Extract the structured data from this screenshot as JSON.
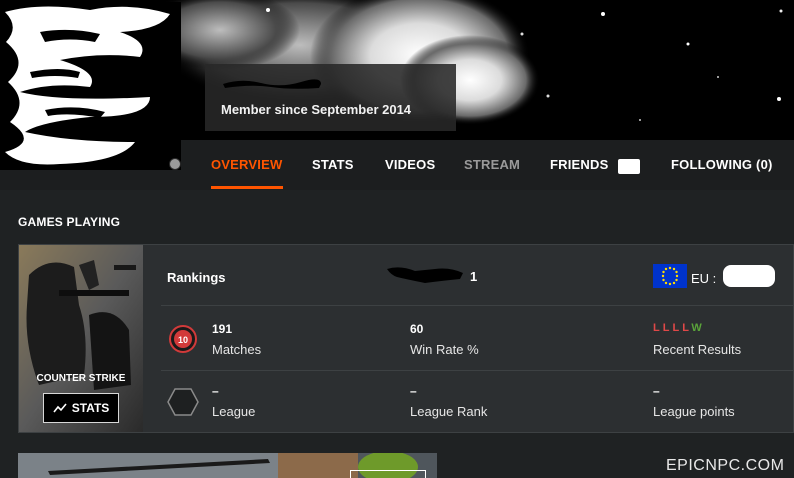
{
  "profile": {
    "member_since": "Member since   September 2014"
  },
  "nav": {
    "overview": "OVERVIEW",
    "stats": "STATS",
    "videos": "VIDEOS",
    "stream": "STREAM",
    "friends": "FRIENDS",
    "following": "FOLLOWING (0)"
  },
  "games_section": {
    "title": "GAMES PLAYING"
  },
  "game": {
    "cover_title": "COUNTER STRIKE",
    "stats_button": "STATS",
    "rankings_label": "Rankings",
    "ranking_value": "1",
    "region_label": "EU :",
    "level": "10",
    "matches_value": "191",
    "matches_label": "Matches",
    "win_rate_value": "60",
    "win_rate_label": "Win Rate %",
    "recent_results": [
      {
        "r": "L",
        "color": "#e04848"
      },
      {
        "r": "L",
        "color": "#e04848"
      },
      {
        "r": "L",
        "color": "#e04848"
      },
      {
        "r": "L",
        "color": "#e04848"
      },
      {
        "r": "W",
        "color": "#5aa33a"
      }
    ],
    "recent_results_label": "Recent Results",
    "league_value": "–",
    "league_label": "League",
    "league_rank_value": "–",
    "league_rank_label": "League Rank",
    "league_points_value": "–",
    "league_points_label": "League points"
  },
  "colors": {
    "accent": "#ff5500",
    "loss": "#e04848",
    "win": "#5aa33a",
    "eu_flag": "#0033cc"
  },
  "watermark": "EPICNPC.COM"
}
